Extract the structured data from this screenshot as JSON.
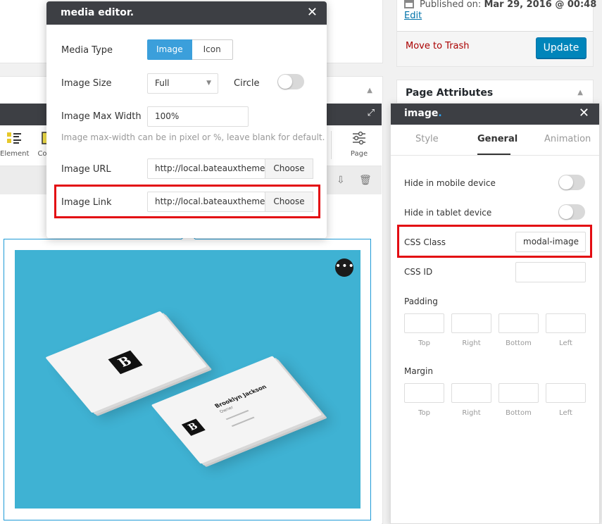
{
  "publish": {
    "published_label": "Published on:",
    "published_date": "Mar 29, 2016 @ 00:48",
    "edit_link": "Edit",
    "trash_link": "Move to Trash",
    "update_button": "Update"
  },
  "page_attributes": {
    "title": "Page Attributes"
  },
  "builder": {
    "tools": [
      "Element",
      "Co",
      "Page"
    ]
  },
  "card": {
    "name": "Brooklyn Jackson",
    "role": "Owner",
    "logo": "B"
  },
  "media_editor": {
    "title": "media editor.",
    "media_type_label": "Media Type",
    "media_type_options": [
      "Image",
      "Icon"
    ],
    "media_type_selected": "Image",
    "image_size_label": "Image Size",
    "image_size_value": "Full",
    "circle_label": "Circle",
    "circle_on": false,
    "max_width_label": "Image Max Width",
    "max_width_value": "100%",
    "max_width_help": "Image max-width can be in pixel or %, leave blank for default.",
    "image_url_label": "Image URL",
    "image_url_value": "http://local.bateauxtheme",
    "image_link_label": "Image Link",
    "image_link_value": "http://local.bateauxtheme",
    "choose_label": "Choose"
  },
  "image_panel": {
    "title": "image",
    "title_dot": ".",
    "tabs": [
      "Style",
      "General",
      "Animation"
    ],
    "active_tab": "General",
    "hide_mobile_label": "Hide in mobile device",
    "hide_tablet_label": "Hide in tablet device",
    "css_class_label": "CSS Class",
    "css_class_value": "modal-image",
    "css_id_label": "CSS ID",
    "css_id_value": "",
    "padding_label": "Padding",
    "margin_label": "Margin",
    "sides": [
      "Top",
      "Right",
      "Bottom",
      "Left"
    ]
  },
  "colors": {
    "accent": "#3b9fdb",
    "header": "#3d3f44",
    "highlight": "#e30d13",
    "image_bg": "#3fb2d3",
    "update": "#0085ba"
  }
}
